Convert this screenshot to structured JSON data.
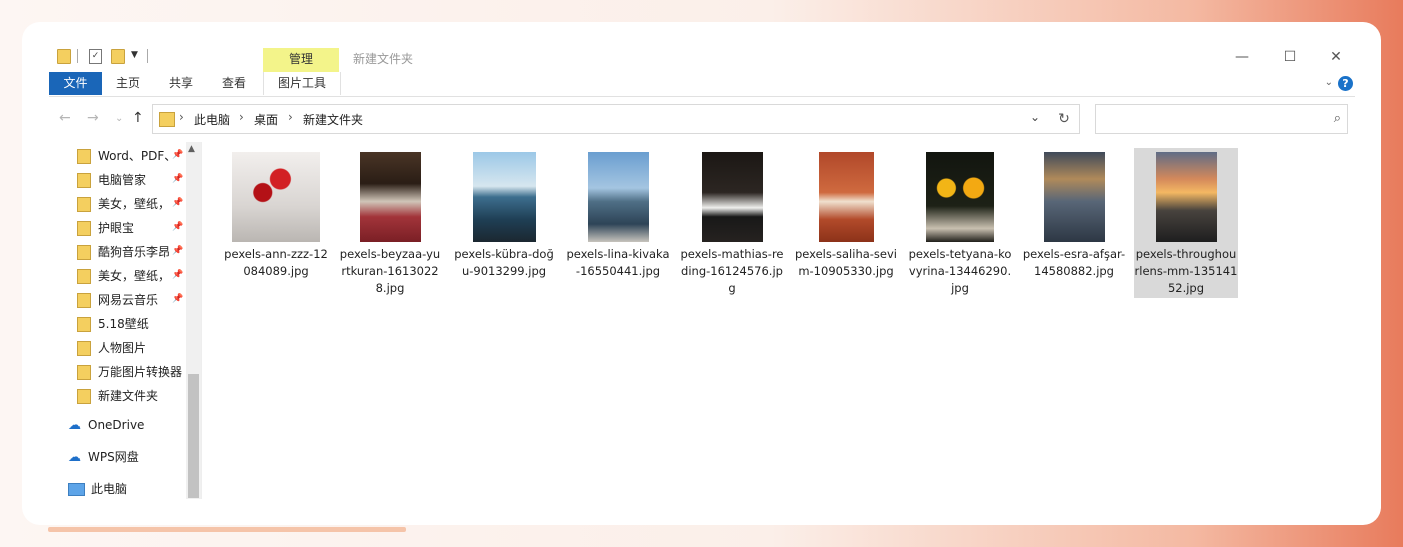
{
  "window": {
    "title": "新建文件夹",
    "context_tab": "管理",
    "controls": {
      "minimize": "—",
      "maximize": "☐",
      "close": "✕"
    }
  },
  "ribbon": {
    "tabs": [
      "文件",
      "主页",
      "共享",
      "查看",
      "图片工具"
    ],
    "help": "?"
  },
  "address": {
    "crumbs": [
      "此电脑",
      "桌面",
      "新建文件夹"
    ],
    "separator": "›"
  },
  "search": {
    "placeholder": ""
  },
  "sidebar": {
    "quick_access": [
      {
        "label": "Word、PDF、",
        "pinned": true
      },
      {
        "label": "电脑管家",
        "pinned": true
      },
      {
        "label": "美女，壁纸，",
        "pinned": true
      },
      {
        "label": "护眼宝",
        "pinned": true
      },
      {
        "label": "酷狗音乐李昂",
        "pinned": true
      },
      {
        "label": "美女，壁纸，",
        "pinned": true
      },
      {
        "label": "网易云音乐",
        "pinned": true
      },
      {
        "label": "5.18壁纸",
        "pinned": false
      },
      {
        "label": "人物图片",
        "pinned": false
      },
      {
        "label": "万能图片转换器",
        "pinned": false
      },
      {
        "label": "新建文件夹",
        "pinned": false
      }
    ],
    "cloud": [
      {
        "label": "OneDrive",
        "icon": "cloud-icon"
      },
      {
        "label": "WPS网盘",
        "icon": "cloud-icon"
      }
    ],
    "this_pc": "此电脑"
  },
  "files": [
    {
      "name": "pexels-ann-zzz-12084089.jpg",
      "selected": false
    },
    {
      "name": "pexels-beyzaa-yurtkuran-16130228.jpg",
      "selected": false
    },
    {
      "name": "pexels-kübra-doğu-9013299.jpg",
      "selected": false
    },
    {
      "name": "pexels-lina-kivaka-16550441.jpg",
      "selected": false
    },
    {
      "name": "pexels-mathias-reding-16124576.jpg",
      "selected": false
    },
    {
      "name": "pexels-saliha-sevim-10905330.jpg",
      "selected": false
    },
    {
      "name": "pexels-tetyana-kovyrina-13446290.jpg",
      "selected": false
    },
    {
      "name": "pexels-esra-afşar-14580882.jpg",
      "selected": false
    },
    {
      "name": "pexels-throughourlens-mm-13514152.jpg",
      "selected": true
    }
  ]
}
